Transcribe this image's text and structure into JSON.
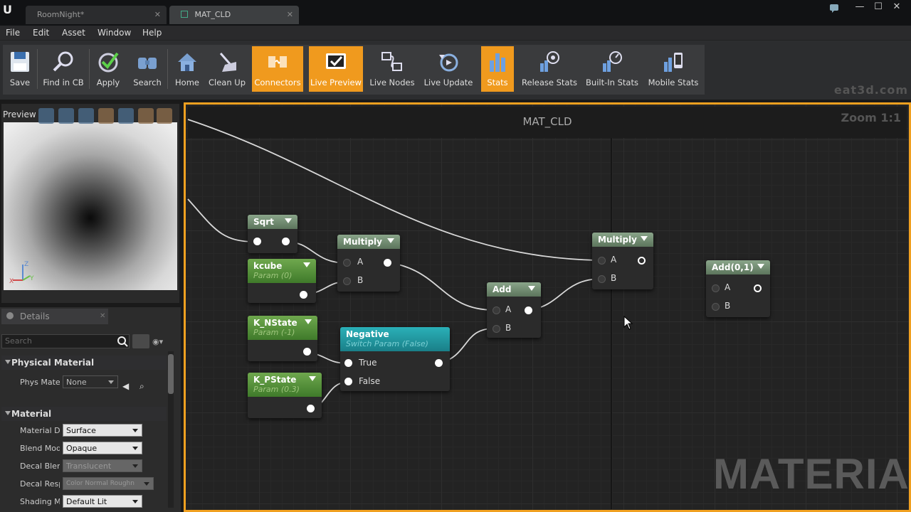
{
  "titlebar": {
    "tabs": [
      {
        "label": "RoomNight*",
        "close": "✕"
      },
      {
        "label": "MAT_CLD",
        "close": "✕"
      }
    ],
    "controls": {
      "minimize": "—",
      "maximize": "☐",
      "close": "✕"
    }
  },
  "menu": [
    "File",
    "Edit",
    "Asset",
    "Window",
    "Help"
  ],
  "toolbar": {
    "buttons": [
      {
        "label": "Save",
        "icon": "save-icon",
        "active": false
      },
      {
        "label": "Find in CB",
        "icon": "find-in-cb-icon",
        "active": false
      },
      {
        "label": "Apply",
        "icon": "apply-icon",
        "active": false
      },
      {
        "label": "Search",
        "icon": "search-icon",
        "active": false
      },
      {
        "label": "Home",
        "icon": "home-icon",
        "active": false
      },
      {
        "label": "Clean Up",
        "icon": "clean-up-icon",
        "active": false
      },
      {
        "label": "Connectors",
        "icon": "connectors-icon",
        "active": true
      },
      {
        "label": "Live Preview",
        "icon": "live-preview-icon",
        "active": true
      },
      {
        "label": "Live Nodes",
        "icon": "live-nodes-icon",
        "active": false
      },
      {
        "label": "Live Update",
        "icon": "live-update-icon",
        "active": false
      },
      {
        "label": "Stats",
        "icon": "stats-icon",
        "active": true
      },
      {
        "label": "Release Stats",
        "icon": "release-stats-icon",
        "active": false
      },
      {
        "label": "Built-In Stats",
        "icon": "built-in-stats-icon",
        "active": false
      },
      {
        "label": "Mobile Stats",
        "icon": "mobile-stats-icon",
        "active": false
      }
    ],
    "watermark": "eat3d.com",
    "active_color": "#f09a1e"
  },
  "preview": {
    "label": "Preview"
  },
  "details": {
    "tab_label": "Details",
    "search_placeholder": "Search",
    "categories": [
      {
        "name": "Physical Material",
        "props": [
          {
            "label": "Phys Mater",
            "value": "None"
          }
        ]
      },
      {
        "name": "Material",
        "props": [
          {
            "label": "Material D",
            "value": "Surface"
          },
          {
            "label": "Blend Mod",
            "value": "Opaque"
          },
          {
            "label": "Decal Blen",
            "value": "Translucent"
          },
          {
            "label": "Decal Resp",
            "value": "Color Normal Roughn"
          },
          {
            "label": "Shading M",
            "value": "Default Lit"
          }
        ]
      }
    ]
  },
  "graph": {
    "title": "MAT_CLD",
    "zoom": "Zoom 1:1",
    "watermark": "MATERIAL",
    "nodes": {
      "sqrt": {
        "title": "Sqrt"
      },
      "kcube": {
        "title": "kcube",
        "sub": "Param (0)"
      },
      "multiply1": {
        "title": "Multiply",
        "pins": [
          "A",
          "B"
        ]
      },
      "k_nstate": {
        "title": "K_NState",
        "sub": "Param (-1)"
      },
      "k_pstate": {
        "title": "K_PState",
        "sub": "Param (0.3)"
      },
      "negative": {
        "title": "Negative",
        "sub": "Switch Param (False)",
        "pins": [
          "True",
          "False"
        ]
      },
      "add": {
        "title": "Add",
        "pins": [
          "A",
          "B"
        ]
      },
      "multiply2": {
        "title": "Multiply",
        "pins": [
          "A",
          "B"
        ]
      },
      "add01": {
        "title": "Add(0,1)",
        "pins": [
          "A",
          "B"
        ]
      }
    }
  }
}
